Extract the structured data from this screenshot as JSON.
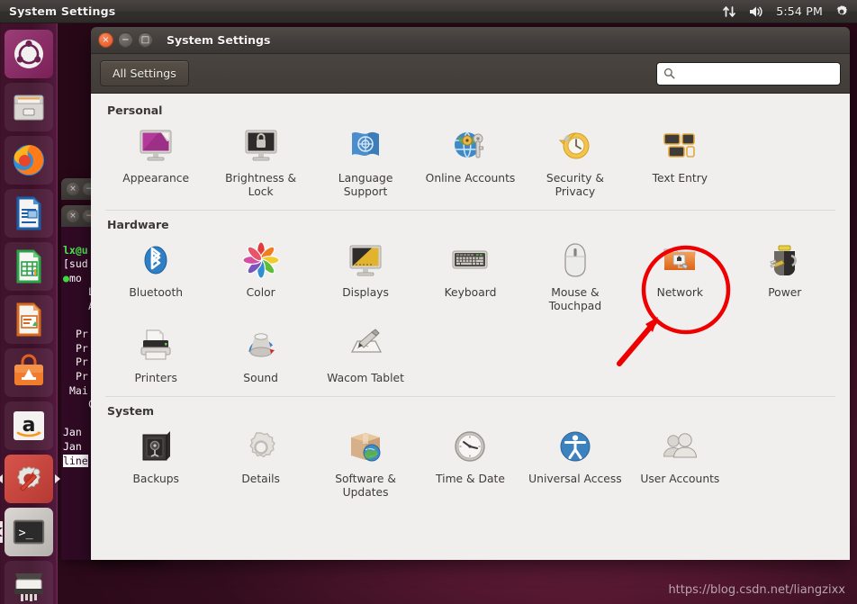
{
  "panel": {
    "title": "System Settings",
    "clock": "5:54 PM",
    "icons": [
      "network-updown-icon",
      "volume-icon",
      "gear-icon"
    ]
  },
  "launcher": {
    "items": [
      {
        "name": "ubuntu-dash",
        "label": "Dash Home"
      },
      {
        "name": "files",
        "label": "Files"
      },
      {
        "name": "firefox",
        "label": "Firefox Web Browser"
      },
      {
        "name": "libreoffice-writer",
        "label": "LibreOffice Writer"
      },
      {
        "name": "libreoffice-calc",
        "label": "LibreOffice Calc"
      },
      {
        "name": "libreoffice-impress",
        "label": "LibreOffice Impress"
      },
      {
        "name": "ubuntu-software",
        "label": "Ubuntu Software"
      },
      {
        "name": "amazon",
        "label": "Amazon"
      },
      {
        "name": "system-settings",
        "label": "System Settings"
      },
      {
        "name": "terminal",
        "label": "Terminal"
      },
      {
        "name": "printer-shredder",
        "label": "Printers"
      }
    ]
  },
  "background_terminal": {
    "lines": [
      "lx@u",
      "[sud",
      "mo",
      "L",
      "A",
      "",
      "Pr",
      "Pr",
      "Pr",
      "Pr",
      "Mai",
      "C",
      "",
      "Jan",
      "Jan",
      "line"
    ]
  },
  "window": {
    "title": "System Settings",
    "buttons": {
      "close": "×",
      "minimize": "−",
      "maximize": "□"
    }
  },
  "toolbar": {
    "all_settings_label": "All Settings",
    "search_placeholder": "",
    "search_value": ""
  },
  "sections": [
    {
      "title": "Personal",
      "items": [
        {
          "label": "Appearance",
          "icon": "appearance-icon"
        },
        {
          "label": "Brightness & Lock",
          "icon": "brightness-lock-icon"
        },
        {
          "label": "Language Support",
          "icon": "language-support-icon"
        },
        {
          "label": "Online Accounts",
          "icon": "online-accounts-icon"
        },
        {
          "label": "Security & Privacy",
          "icon": "security-privacy-icon"
        },
        {
          "label": "Text Entry",
          "icon": "text-entry-icon"
        }
      ]
    },
    {
      "title": "Hardware",
      "items": [
        {
          "label": "Bluetooth",
          "icon": "bluetooth-icon"
        },
        {
          "label": "Color",
          "icon": "color-icon"
        },
        {
          "label": "Displays",
          "icon": "displays-icon"
        },
        {
          "label": "Keyboard",
          "icon": "keyboard-icon"
        },
        {
          "label": "Mouse & Touchpad",
          "icon": "mouse-touchpad-icon"
        },
        {
          "label": "Network",
          "icon": "network-icon"
        },
        {
          "label": "Power",
          "icon": "power-icon"
        },
        {
          "label": "Printers",
          "icon": "printers-icon"
        },
        {
          "label": "Sound",
          "icon": "sound-icon"
        },
        {
          "label": "Wacom Tablet",
          "icon": "wacom-tablet-icon"
        }
      ]
    },
    {
      "title": "System",
      "items": [
        {
          "label": "Backups",
          "icon": "backups-icon"
        },
        {
          "label": "Details",
          "icon": "details-icon"
        },
        {
          "label": "Software & Updates",
          "icon": "software-updates-icon"
        },
        {
          "label": "Time & Date",
          "icon": "time-date-icon"
        },
        {
          "label": "Universal Access",
          "icon": "universal-access-icon"
        },
        {
          "label": "User Accounts",
          "icon": "user-accounts-icon"
        }
      ]
    }
  ],
  "annotation": {
    "target_label": "Network",
    "color": "#ee0000",
    "shape": "circle-with-arrow"
  },
  "watermark": "https://blog.csdn.net/liangzixx",
  "colors": {
    "panel_bg": "#3b3836",
    "launcher_bg": "#3e1129",
    "window_chrome": "#443f3c",
    "content_bg": "#f0efed",
    "accent_orange": "#e6541f",
    "annotation_red": "#ee0000",
    "desktop": "#53172f"
  }
}
